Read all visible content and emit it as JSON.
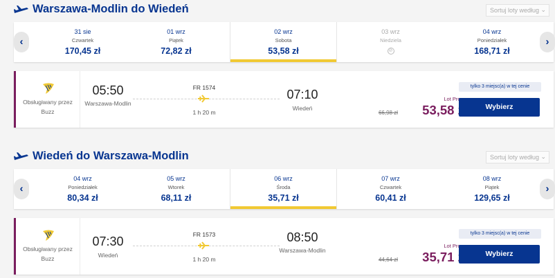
{
  "colors": {
    "brand_blue": "#073590",
    "promo_purple": "#7a1d5e",
    "selected_bar": "#f1c933",
    "card_bg": "#ffffff",
    "page_bg": "#f4f4f4"
  },
  "sections": [
    {
      "title": "Warszawa-Modlin do Wiedeń",
      "sort_label": "Sortuj loty według",
      "days": [
        {
          "date": "31 sie",
          "weekday": "Czwartek",
          "price": "170,45 zł"
        },
        {
          "date": "01 wrz",
          "weekday": "Piątek",
          "price": "72,82 zł"
        },
        {
          "date": "02 wrz",
          "weekday": "Sobota",
          "price": "53,58 zł"
        },
        {
          "date": "03 wrz",
          "weekday": "Niedziela",
          "price": ""
        },
        {
          "date": "04 wrz",
          "weekday": "Poniedziałek",
          "price": "168,71 zł"
        }
      ],
      "selected_index": 2,
      "flight": {
        "operator": "Obsługiwany przez Buzz",
        "dep_time": "05:50",
        "dep_airport": "Warszawa-Modlin",
        "flight_no": "FR 1574",
        "duration": "1 h 20 m",
        "arr_time": "07:10",
        "arr_airport": "Wiedeń",
        "promo_label": "Lot Promo",
        "old_price": "66,98 zł",
        "price": "53,58 zł",
        "seats_note": "tylko 3 miejsc(a) w tej cenie",
        "select_label": "Wybierz"
      }
    },
    {
      "title": "Wiedeń do Warszawa-Modlin",
      "sort_label": "Sortuj loty według",
      "days": [
        {
          "date": "04 wrz",
          "weekday": "Poniedziałek",
          "price": "80,34 zł"
        },
        {
          "date": "05 wrz",
          "weekday": "Wtorek",
          "price": "68,11 zł"
        },
        {
          "date": "06 wrz",
          "weekday": "Środa",
          "price": "35,71 zł"
        },
        {
          "date": "07 wrz",
          "weekday": "Czwartek",
          "price": "60,41 zł"
        },
        {
          "date": "08 wrz",
          "weekday": "Piątek",
          "price": "129,65 zł"
        }
      ],
      "selected_index": 2,
      "flight": {
        "operator": "Obsługiwany przez Buzz",
        "dep_time": "07:30",
        "dep_airport": "Wiedeń",
        "flight_no": "FR 1573",
        "duration": "1 h 20 m",
        "arr_time": "08:50",
        "arr_airport": "Warszawa-Modlin",
        "promo_label": "Lot Promo",
        "old_price": "44,64 zł",
        "price": "35,71 zł",
        "seats_note": "tylko 3 miejsc(a) w tej cenie",
        "select_label": "Wybierz"
      }
    }
  ]
}
